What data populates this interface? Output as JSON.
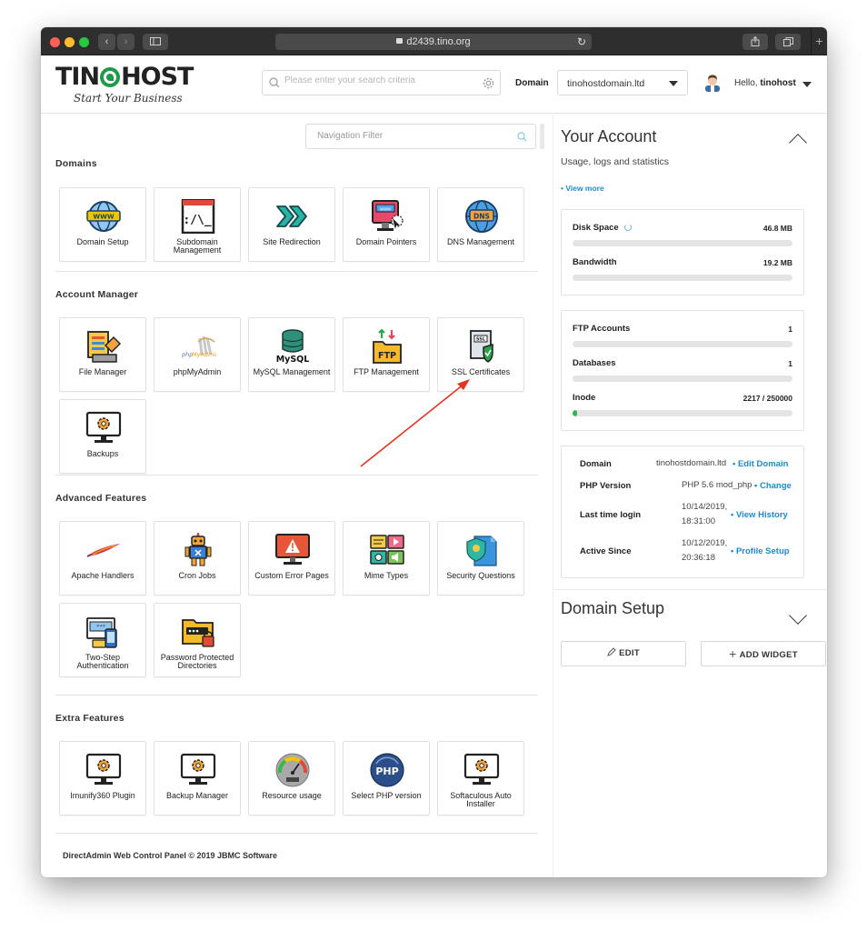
{
  "browser": {
    "url": "d2439.tino.org"
  },
  "brand": {
    "logo_left": "TIN",
    "logo_right": "HOST",
    "tagline": "Start Your Business",
    "accent": "#1e9b47"
  },
  "header": {
    "search_placeholder": "Please enter your search criteria",
    "domain_label": "Domain",
    "domain_value": "tinohostdomain.ltd",
    "hello_prefix": "Hello,",
    "username": "tinohost"
  },
  "nav_filter": {
    "placeholder": "Navigation Filter"
  },
  "sections": [
    {
      "title": "Domains",
      "items": [
        {
          "label": "Domain Setup",
          "icon": "globe-www-icon"
        },
        {
          "label": "Subdomain Management",
          "icon": "terminal-window-icon"
        },
        {
          "label": "Site Redirection",
          "icon": "redirect-arrows-icon"
        },
        {
          "label": "Domain Pointers",
          "icon": "monitor-pointer-icon"
        },
        {
          "label": "DNS Management",
          "icon": "globe-dns-icon"
        }
      ]
    },
    {
      "title": "Account Manager",
      "items": [
        {
          "label": "File Manager",
          "icon": "file-folder-icon"
        },
        {
          "label": "phpMyAdmin",
          "icon": "phpmyadmin-logo-icon"
        },
        {
          "label": "MySQL Management",
          "icon": "mysql-database-icon"
        },
        {
          "label": "FTP Management",
          "icon": "ftp-folder-icon"
        },
        {
          "label": "SSL Certificates",
          "icon": "ssl-certificate-icon"
        },
        {
          "label": "Backups",
          "icon": "monitor-gear-icon"
        }
      ]
    },
    {
      "title": "Advanced Features",
      "items": [
        {
          "label": "Apache Handlers",
          "icon": "apache-feather-icon"
        },
        {
          "label": "Cron Jobs",
          "icon": "robot-icon"
        },
        {
          "label": "Custom Error Pages",
          "icon": "monitor-warning-icon"
        },
        {
          "label": "Mime Types",
          "icon": "media-types-icon"
        },
        {
          "label": "Security Questions",
          "icon": "shield-document-icon"
        },
        {
          "label": "Two-Step Authentication",
          "icon": "two-step-auth-icon"
        },
        {
          "label": "Password Protected Directories",
          "icon": "locked-folder-icon"
        }
      ]
    },
    {
      "title": "Extra Features",
      "items": [
        {
          "label": "Imunify360 Plugin",
          "icon": "monitor-gear-icon"
        },
        {
          "label": "Backup Manager",
          "icon": "monitor-gear-icon"
        },
        {
          "label": "Resource usage",
          "icon": "gauge-icon"
        },
        {
          "label": "Select PHP version",
          "icon": "php-badge-icon"
        },
        {
          "label": "Softaculous Auto Installer",
          "icon": "monitor-gear-icon"
        }
      ]
    }
  ],
  "footer": {
    "text": "DirectAdmin Web Control Panel © 2019 JBMC Software"
  },
  "account": {
    "title": "Your Account",
    "subtitle": "Usage, logs and statistics",
    "view_more": "• View more",
    "stats_group1": [
      {
        "name": "Disk Space",
        "value": "46.8 MB",
        "fraction": 0.0
      },
      {
        "name": "Bandwidth",
        "value": "19.2 MB",
        "fraction": 0.0
      }
    ],
    "stats_group2": [
      {
        "name": "FTP Accounts",
        "value": "1",
        "fraction": 0.0
      },
      {
        "name": "Databases",
        "value": "1",
        "fraction": 0.0
      },
      {
        "name": "Inode",
        "value": "2217 / 250000",
        "fraction": 0.009
      }
    ],
    "info": [
      {
        "key": "Domain",
        "value": "tinohostdomain.ltd",
        "value2": "",
        "action": "• Edit Domain"
      },
      {
        "key": "PHP Version",
        "value": "PHP 5.6 mod_php",
        "value2": "",
        "action": "• Change"
      },
      {
        "key": "Last time login",
        "value": "10/14/2019,",
        "value2": "18:31:00",
        "action": "• View History"
      },
      {
        "key": "Active Since",
        "value": "10/12/2019,",
        "value2": "20:36:18",
        "action": "• Profile Setup"
      }
    ]
  },
  "domain_setup": {
    "title": "Domain Setup",
    "edit_label": "EDIT",
    "add_widget_label": "ADD WIDGET"
  },
  "colors": {
    "link": "#1a8bd1",
    "progress": "#2eb84f",
    "annotation_arrow": "#e8321f"
  }
}
